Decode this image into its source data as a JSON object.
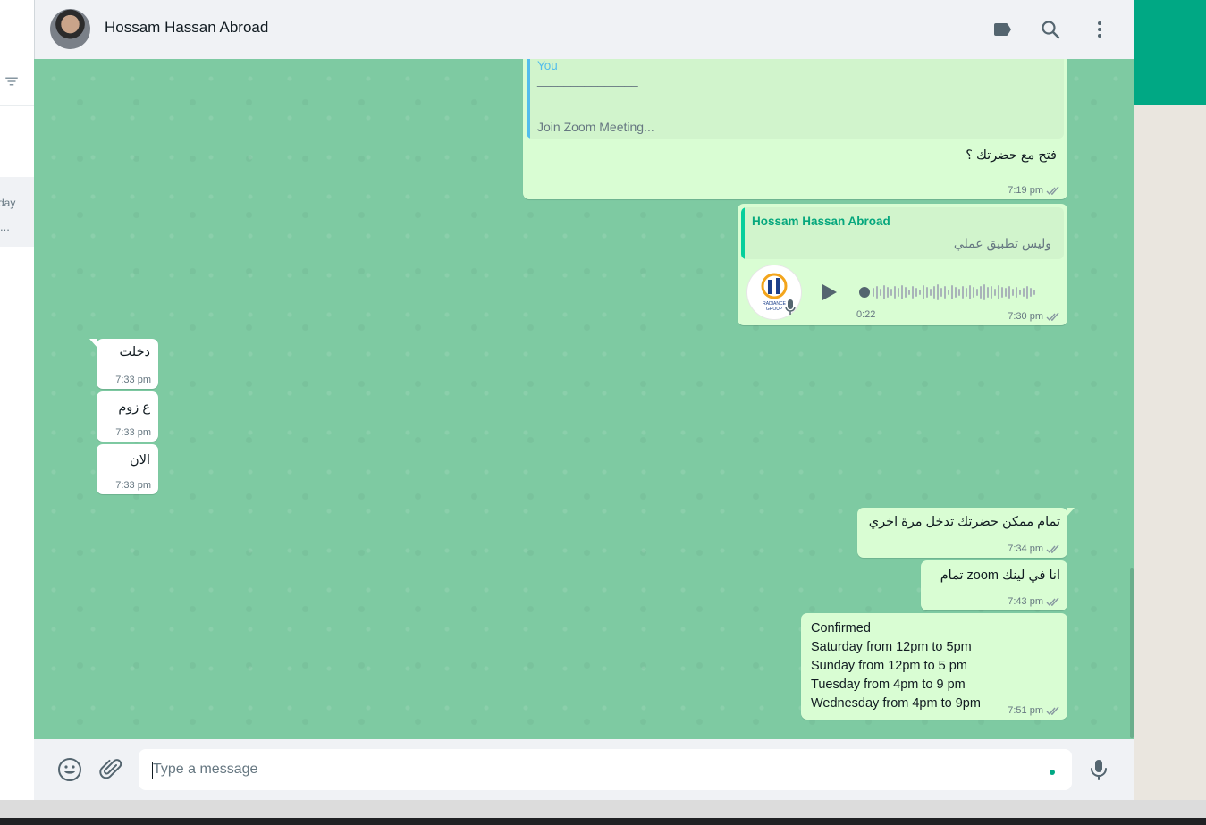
{
  "sidebar": {
    "preview_day": "day",
    "preview_ellipsis": "..."
  },
  "header": {
    "contact_name": "Hossam Hassan Abroad"
  },
  "messages": {
    "m1": {
      "quote_author": "You",
      "quote_line": "_______________",
      "quote_text": "Join Zoom Meeting...",
      "text": "فتح مع حضرتك ؟",
      "time": "7:19 pm"
    },
    "m2": {
      "quote_author": "Hossam Hassan Abroad",
      "quote_text": "وليس تطبيق عملي",
      "voice_duration": "0:22",
      "avatar_brand": "RADIANCE GROUP",
      "time": "7:30 pm"
    },
    "m3": {
      "text": "دخلت",
      "time": "7:33 pm"
    },
    "m4": {
      "text": "ع زوم",
      "time": "7:33 pm"
    },
    "m5": {
      "text": "الان",
      "time": "7:33 pm"
    },
    "m6": {
      "text": "تمام ممكن حضرتك تدخل مرة اخري",
      "time": "7:34 pm"
    },
    "m7": {
      "text": "انا في لينك zoom تمام",
      "time": "7:43 pm"
    },
    "m8": {
      "lines": [
        "Confirmed",
        "Saturday from 12pm to 5pm",
        "Sunday from 12pm to 5 pm",
        "Tuesday from 4pm to 9 pm",
        "Wednesday from 4pm to 9pm"
      ],
      "time": "7:51 pm"
    }
  },
  "composer": {
    "placeholder": "Type a message"
  },
  "colors": {
    "accent": "#00a884",
    "outgoing_bubble": "#d9fdd3",
    "chat_background": "#7ecaa2",
    "quote_you_bar": "#53bdeb",
    "quote_contact_bar": "#06cf9c"
  },
  "icons": {
    "header": [
      "label-icon",
      "search-icon",
      "menu-dots-icon"
    ],
    "footer": [
      "emoji-icon",
      "attach-icon",
      "microphone-icon"
    ]
  }
}
